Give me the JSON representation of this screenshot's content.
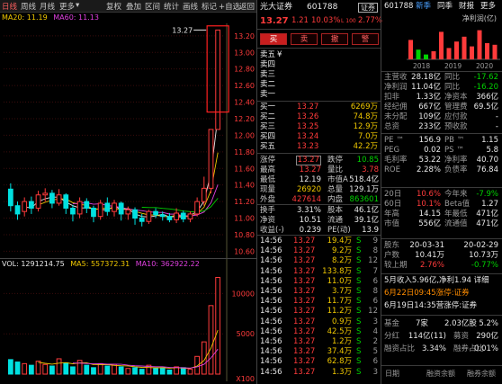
{
  "toolbar": {
    "period": "日线",
    "weekly": "周线",
    "month": "月线",
    "more": "更多",
    "fuquan": "复权",
    "overlay": "叠加",
    "compare": "区间",
    "stats": "统计",
    "draw": "画线",
    "mark": "标记",
    "self": "+自选",
    "back": "返回"
  },
  "ma": {
    "ma20": "MA20: 11.19",
    "ma60": "MA60: 11.13"
  },
  "vol": {
    "vol": "VOL: 1291214.75",
    "ma5": "MA5: 557372.31",
    "ma10": "MA10: 362922.22"
  },
  "price_axis": [
    "13.20",
    "13.00",
    "12.80",
    "12.60",
    "12.40",
    "12.20",
    "12.00",
    "11.80",
    "11.60",
    "11.40",
    "11.20",
    "11.00",
    "10.80",
    "10.60"
  ],
  "vol_axis": [
    "10000",
    "5000",
    "X100"
  ],
  "high_label": "13.27",
  "candles": [
    {
      "o": 11.35,
      "c": 11.15,
      "h": 11.42,
      "l": 11.08,
      "v": 1800
    },
    {
      "o": 11.15,
      "c": 11.05,
      "h": 11.2,
      "l": 10.98,
      "v": 1500
    },
    {
      "o": 11.08,
      "c": 11.2,
      "h": 11.25,
      "l": 11.02,
      "v": 1300
    },
    {
      "o": 11.2,
      "c": 11.12,
      "h": 11.26,
      "l": 11.05,
      "v": 1100
    },
    {
      "o": 11.12,
      "c": 11.28,
      "h": 11.33,
      "l": 11.08,
      "v": 1600
    },
    {
      "o": 11.28,
      "c": 11.3,
      "h": 11.36,
      "l": 11.2,
      "v": 1200
    },
    {
      "o": 11.3,
      "c": 11.18,
      "h": 11.34,
      "l": 11.12,
      "v": 1000
    },
    {
      "o": 11.18,
      "c": 11.28,
      "h": 11.35,
      "l": 11.15,
      "v": 1900
    },
    {
      "o": 11.28,
      "c": 11.12,
      "h": 11.3,
      "l": 11.05,
      "v": 1400
    },
    {
      "o": 11.12,
      "c": 11.05,
      "h": 11.16,
      "l": 10.96,
      "v": 900
    },
    {
      "o": 11.05,
      "c": 11.2,
      "h": 11.25,
      "l": 11.0,
      "v": 1700
    },
    {
      "o": 11.2,
      "c": 11.12,
      "h": 11.24,
      "l": 11.06,
      "v": 1100
    },
    {
      "o": 11.12,
      "c": 11.02,
      "h": 11.15,
      "l": 10.95,
      "v": 800
    },
    {
      "o": 11.02,
      "c": 11.18,
      "h": 11.22,
      "l": 10.98,
      "v": 1300
    },
    {
      "o": 11.18,
      "c": 11.08,
      "h": 11.25,
      "l": 11.03,
      "v": 1000
    },
    {
      "o": 11.08,
      "c": 11.18,
      "h": 11.22,
      "l": 11.02,
      "v": 1200
    },
    {
      "o": 11.18,
      "c": 11.05,
      "h": 11.2,
      "l": 10.97,
      "v": 900
    },
    {
      "o": 11.05,
      "c": 11.1,
      "h": 11.14,
      "l": 10.98,
      "v": 700
    },
    {
      "o": 11.1,
      "c": 11.0,
      "h": 11.13,
      "l": 10.92,
      "v": 800
    },
    {
      "o": 11.0,
      "c": 10.96,
      "h": 11.05,
      "l": 10.9,
      "v": 600
    },
    {
      "o": 10.96,
      "c": 11.08,
      "h": 11.1,
      "l": 10.93,
      "v": 1100
    },
    {
      "o": 11.08,
      "c": 11.04,
      "h": 11.12,
      "l": 11.0,
      "v": 700
    },
    {
      "o": 11.04,
      "c": 11.02,
      "h": 11.08,
      "l": 10.97,
      "v": 800
    },
    {
      "o": 11.02,
      "c": 10.98,
      "h": 11.06,
      "l": 10.95,
      "v": 500
    },
    {
      "o": 10.98,
      "c": 11.06,
      "h": 11.12,
      "l": 10.94,
      "v": 900
    },
    {
      "o": 11.06,
      "c": 10.99,
      "h": 11.09,
      "l": 10.95,
      "v": 800
    },
    {
      "o": 10.99,
      "c": 11.05,
      "h": 11.08,
      "l": 10.95,
      "v": 600
    },
    {
      "o": 11.05,
      "c": 11.2,
      "h": 11.25,
      "l": 11.02,
      "v": 2200
    },
    {
      "o": 11.2,
      "c": 11.36,
      "h": 11.5,
      "l": 11.15,
      "v": 4000
    },
    {
      "o": 11.36,
      "c": 12.07,
      "h": 12.07,
      "l": 11.3,
      "v": 8500
    },
    {
      "o": 12.07,
      "c": 13.27,
      "h": 13.27,
      "l": 12.25,
      "v": 12000
    }
  ],
  "stock": {
    "name": "光大证券",
    "code": "601788",
    "price": "13.27",
    "change": "1.21",
    "pct": "10.03%",
    "sector": "证券",
    "sector_pct": "2.77%",
    "flag": "L 100"
  },
  "actions": [
    "买",
    "卖",
    "撤",
    "警"
  ],
  "asks": [
    {
      "l": "卖五",
      "p": "",
      "v": "¥"
    },
    {
      "l": "卖四",
      "p": "",
      "v": ""
    },
    {
      "l": "卖三",
      "p": "",
      "v": ""
    },
    {
      "l": "卖二",
      "p": "",
      "v": ""
    },
    {
      "l": "卖一",
      "p": "",
      "v": ""
    }
  ],
  "bids": [
    {
      "l": "买一",
      "p": "13.27",
      "v": "6269万"
    },
    {
      "l": "买二",
      "p": "13.26",
      "v": "74.8万"
    },
    {
      "l": "买三",
      "p": "13.25",
      "v": "12.9万"
    },
    {
      "l": "买四",
      "p": "13.24",
      "v": "7.0万"
    },
    {
      "l": "买五",
      "p": "13.23",
      "v": "42.2万"
    }
  ],
  "stats": [
    [
      {
        "t": "涨停"
      },
      {
        "t": "13.27",
        "c": "r",
        "box": true
      },
      {
        "t": "跌停"
      },
      {
        "t": "10.85",
        "c": "g"
      }
    ],
    [
      {
        "t": "最高"
      },
      {
        "t": "13.27",
        "c": "r"
      },
      {
        "t": "量比"
      },
      {
        "t": "3.78",
        "c": "r"
      }
    ],
    [
      {
        "t": "最低"
      },
      {
        "t": "12.19",
        "c": "w"
      },
      {
        "t": "市值A"
      },
      {
        "t": "518.4亿",
        "c": "w"
      }
    ],
    [
      {
        "t": "现量"
      },
      {
        "t": "26920",
        "c": "y"
      },
      {
        "t": "总量"
      },
      {
        "t": "129.1万",
        "c": "w"
      }
    ],
    [
      {
        "t": "外盘"
      },
      {
        "t": "427614",
        "c": "r"
      },
      {
        "t": "内盘"
      },
      {
        "t": "863601",
        "c": "g"
      }
    ],
    [
      {
        "t": "换手"
      },
      {
        "t": "3.31%",
        "c": "w"
      },
      {
        "t": "股本"
      },
      {
        "t": "46.1亿",
        "c": "w"
      }
    ],
    [
      {
        "t": "净资"
      },
      {
        "t": "10.51",
        "c": "w"
      },
      {
        "t": "流通"
      },
      {
        "t": "39.1亿",
        "c": "w"
      }
    ],
    [
      {
        "t": "收益(-)"
      },
      {
        "t": "0.239",
        "c": "w"
      },
      {
        "t": "PE(动)"
      },
      {
        "t": "13.9",
        "c": "w"
      }
    ]
  ],
  "ticks": [
    {
      "t": "14:56",
      "p": "13.27",
      "v": "19.4万",
      "d": "S",
      "n": "9"
    },
    {
      "t": "14:56",
      "p": "13.27",
      "v": "9.2万",
      "d": "S",
      "n": "8"
    },
    {
      "t": "14:56",
      "p": "13.27",
      "v": "8.2万",
      "d": "S",
      "n": "12"
    },
    {
      "t": "14:56",
      "p": "13.27",
      "v": "133.8万",
      "d": "S",
      "n": "7"
    },
    {
      "t": "14:56",
      "p": "13.27",
      "v": "11.0万",
      "d": "S",
      "n": "6"
    },
    {
      "t": "14:56",
      "p": "13.27",
      "v": "3.7万",
      "d": "S",
      "n": "8"
    },
    {
      "t": "14:56",
      "p": "13.27",
      "v": "11.7万",
      "d": "S",
      "n": "6"
    },
    {
      "t": "14:56",
      "p": "13.27",
      "v": "11.2万",
      "d": "S",
      "n": "12"
    },
    {
      "t": "14:56",
      "p": "13.27",
      "v": "0.9万",
      "d": "S",
      "n": "3"
    },
    {
      "t": "14:56",
      "p": "13.27",
      "v": "42.5万",
      "d": "S",
      "n": "4"
    },
    {
      "t": "14:56",
      "p": "13.27",
      "v": "1.2万",
      "d": "S",
      "n": "2"
    },
    {
      "t": "14:56",
      "p": "13.27",
      "v": "37.4万",
      "d": "S",
      "n": "5"
    },
    {
      "t": "14:56",
      "p": "13.27",
      "v": "62.8万",
      "d": "S",
      "n": "6"
    },
    {
      "t": "14:56",
      "p": "13.27",
      "v": "1.3万",
      "d": "S",
      "n": "3"
    }
  ],
  "f10": {
    "code": "601788",
    "tabs": [
      "新季",
      "同季",
      "财报",
      "更多"
    ],
    "chart_title": "净利润(亿)",
    "years": [
      "2018",
      "2019",
      "2020"
    ],
    "bars": [
      {
        "v": 0.6,
        "c": "#ff3b3b"
      },
      {
        "v": 0.3,
        "c": "#00d200"
      },
      {
        "v": 0.15,
        "c": "#00d200"
      },
      {
        "v": 0.25,
        "c": "#ff3b3b"
      },
      {
        "v": 0.85,
        "c": "#ff3b3b"
      },
      {
        "v": 0.35,
        "c": "#ff3b3b"
      },
      {
        "v": 0.55,
        "c": "#ff3b3b"
      },
      {
        "v": 0.7,
        "c": "#ff3b3b"
      },
      {
        "v": 0.4,
        "c": "#ff3b3b"
      },
      {
        "v": 0.9,
        "c": "#ff3b3b"
      },
      {
        "v": 0.5,
        "c": "#ff3b3b"
      },
      {
        "v": 0.45,
        "c": "#ff3b3b"
      }
    ]
  },
  "fin": [
    [
      {
        "t": "主营收"
      },
      {
        "t": "28.18亿",
        "c": "w"
      },
      {
        "t": "同比"
      },
      {
        "t": "-17.62",
        "c": "g"
      }
    ],
    [
      {
        "t": "净利润"
      },
      {
        "t": "11.04亿",
        "c": "w"
      },
      {
        "t": "同比"
      },
      {
        "t": "-16.20",
        "c": "g"
      }
    ],
    [
      {
        "t": "扣非"
      },
      {
        "t": "1.33亿",
        "c": "w"
      },
      {
        "t": "净资本"
      },
      {
        "t": "366亿",
        "c": "w"
      }
    ],
    [
      {
        "t": "经纪佣"
      },
      {
        "t": "667亿",
        "c": "w"
      },
      {
        "t": "管理费"
      },
      {
        "t": "69.5亿",
        "c": "w"
      }
    ],
    [
      {
        "t": "未分配"
      },
      {
        "t": "109亿",
        "c": "w"
      },
      {
        "t": "应付款"
      },
      {
        "t": "-",
        "c": "w"
      }
    ],
    [
      {
        "t": "总资"
      },
      {
        "t": "233亿",
        "c": "w"
      },
      {
        "t": "预收款"
      },
      {
        "t": "-",
        "c": "w"
      }
    ]
  ],
  "val": [
    [
      {
        "t": "PE ™"
      },
      {
        "t": "156.9",
        "c": "w"
      },
      {
        "t": "PB ™"
      },
      {
        "t": "1.15",
        "c": "w"
      }
    ],
    [
      {
        "t": "PEG"
      },
      {
        "t": "0.02",
        "c": "w"
      },
      {
        "t": "PS ™"
      },
      {
        "t": "5.8",
        "c": "w"
      }
    ],
    [
      {
        "t": "毛利率"
      },
      {
        "t": "53.22",
        "c": "w"
      },
      {
        "t": "净利率"
      },
      {
        "t": "40.70",
        "c": "w"
      }
    ],
    [
      {
        "t": "ROE"
      },
      {
        "t": "2.28%",
        "c": "w"
      },
      {
        "t": "负债率"
      },
      {
        "t": "76.84",
        "c": "w"
      }
    ]
  ],
  "perf": [
    [
      {
        "t": "20日"
      },
      {
        "t": "10.6%",
        "c": "r"
      },
      {
        "t": "今年来"
      },
      {
        "t": "-7.9%",
        "c": "g"
      }
    ],
    [
      {
        "t": "60日"
      },
      {
        "t": "10.1%",
        "c": "r"
      },
      {
        "t": "Beta值"
      },
      {
        "t": "1.27",
        "c": "w"
      }
    ],
    [
      {
        "t": "年高"
      },
      {
        "t": "14.15",
        "c": "w"
      },
      {
        "t": "年最低"
      },
      {
        "t": "471亿",
        "c": "w"
      }
    ],
    [
      {
        "t": "市值"
      },
      {
        "t": "556亿",
        "c": "w"
      },
      {
        "t": "流通值"
      },
      {
        "t": "471亿",
        "c": "w"
      }
    ]
  ],
  "holders": [
    [
      {
        "t": "股东"
      },
      {
        "t": "20-03-31",
        "c": "w"
      },
      {
        "t": "20-02-29",
        "c": "w"
      }
    ],
    [
      {
        "t": "户数"
      },
      {
        "t": "10.41万",
        "c": "w"
      },
      {
        "t": "10.73万",
        "c": "w"
      }
    ],
    [
      {
        "t": "较上期"
      },
      {
        "t": "2.76%",
        "c": "r"
      },
      {
        "t": "-0.77%",
        "c": "g"
      }
    ]
  ],
  "news": [
    {
      "t": "5月收入5.96亿,净利1.94 详细",
      "c": "w"
    },
    {
      "t": "6月22日09:45涨停:证券",
      "c": "o"
    },
    {
      "t": "6月19日14:35营涨停:证券",
      "c": "w"
    }
  ],
  "extra": [
    [
      {
        "t": "基金"
      },
      {
        "t": "7家",
        "c": "w"
      },
      {
        "t": "2.03亿股",
        "c": "w"
      },
      {
        "t": "5.2%",
        "c": "w"
      }
    ],
    [
      {
        "t": "分红"
      },
      {
        "t": "114亿(11)",
        "c": "w"
      },
      {
        "t": "募资"
      },
      {
        "t": "290亿",
        "c": "w"
      }
    ],
    [
      {
        "t": "融资占比"
      },
      {
        "t": "3.34%",
        "c": "w"
      },
      {
        "t": "融券占比"
      },
      {
        "t": "0.01%",
        "c": "w"
      }
    ]
  ],
  "bottom": {
    "date": "日期",
    "a": "融资余额",
    "b": "融券余额"
  }
}
